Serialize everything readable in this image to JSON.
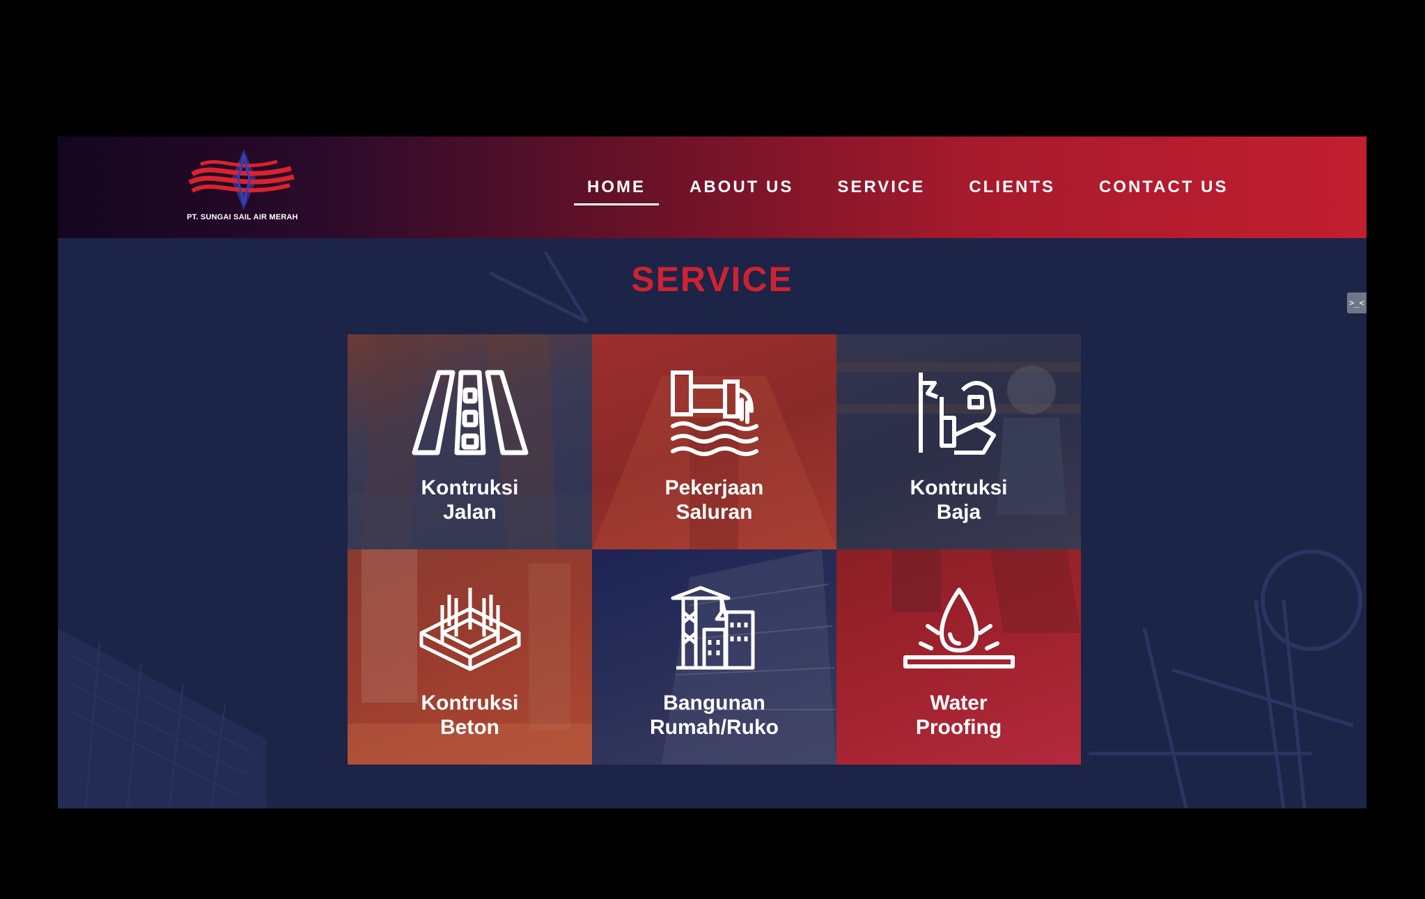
{
  "brand": {
    "company_name": "PT. SUNGAI SAIL AIR MERAH"
  },
  "nav": {
    "items": [
      {
        "label": "HOME",
        "active": true
      },
      {
        "label": "ABOUT US",
        "active": false
      },
      {
        "label": "SERVICE",
        "active": false
      },
      {
        "label": "CLIENTS",
        "active": false
      },
      {
        "label": "CONTACT US",
        "active": false
      }
    ]
  },
  "section": {
    "title": "SERVICE"
  },
  "side_button": {
    "glyph": ">_<"
  },
  "services": [
    {
      "line1": "Kontruksi",
      "line2": "Jalan",
      "icon": "road-icon"
    },
    {
      "line1": "Pekerjaan",
      "line2": "Saluran",
      "icon": "drain-pipe-icon"
    },
    {
      "line1": "Kontruksi",
      "line2": "Baja",
      "icon": "welder-icon"
    },
    {
      "line1": "Kontruksi",
      "line2": "Beton",
      "icon": "concrete-foundation-icon"
    },
    {
      "line1": "Bangunan",
      "line2": "Rumah/Ruko",
      "icon": "building-crane-icon"
    },
    {
      "line1": "Water",
      "line2": "Proofing",
      "icon": "water-drop-icon"
    }
  ],
  "colors": {
    "accent_red": "#cf2230",
    "header_dark": "#14061f",
    "header_red": "#c21f30",
    "page_bg": "#1c2448"
  }
}
